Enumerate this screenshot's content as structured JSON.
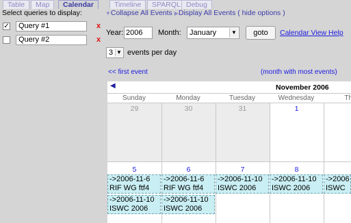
{
  "tabs": [
    "Table",
    "Map",
    "Calendar",
    "Timeline",
    "SPARQL",
    "Debug"
  ],
  "active_tab": "Calendar",
  "queries": {
    "title": "Select queries to display:",
    "items": [
      {
        "label": "Query #1",
        "checked": true,
        "check_mark": "✓",
        "remove": "x"
      },
      {
        "label": "Query #2",
        "checked": false,
        "check_mark": "",
        "remove": "x"
      }
    ]
  },
  "options": {
    "collapse": "Collapse All Events",
    "display": "Display All Events",
    "hide": "( hide options )"
  },
  "form": {
    "year_label": "Year:",
    "year_value": "2006",
    "month_label": "Month:",
    "month_value": "January",
    "goto_label": "goto",
    "help_link": "Calendar View Help",
    "events_per_day_value": "3",
    "events_per_day_label": "events per day"
  },
  "nav": {
    "first_event": "<< first event",
    "most_events": "(month with most events)"
  },
  "calendar": {
    "prev_arrow": "◀",
    "month_title": "November 2006",
    "weekdays": [
      "Sunday",
      "Monday",
      "Tuesday",
      "Wednesday",
      "Thu"
    ],
    "week1": [
      "29",
      "30",
      "31",
      "1"
    ],
    "week2": [
      "5",
      "6",
      "7",
      "8"
    ],
    "events": {
      "sun_a": [
        "->2006-11-6",
        "RIF WG ftf4"
      ],
      "sun_b": [
        "->2006-11-10",
        "ISWC 2006"
      ],
      "mon_a": [
        "->2006-11-6",
        "RIF WG ftf4"
      ],
      "mon_b": [
        "->2006-11-10",
        "ISWC 2006"
      ],
      "tue_a": [
        "->2006-11-10",
        "ISWC 2006"
      ],
      "wed_a": [
        "->2006-11-10",
        "ISWC 2006"
      ],
      "thu_a": [
        "->2006",
        "ISWC"
      ]
    }
  },
  "colors": {
    "event_bg": "#c9eef3",
    "link": "#1a1ae0",
    "remove": "#e01010"
  }
}
